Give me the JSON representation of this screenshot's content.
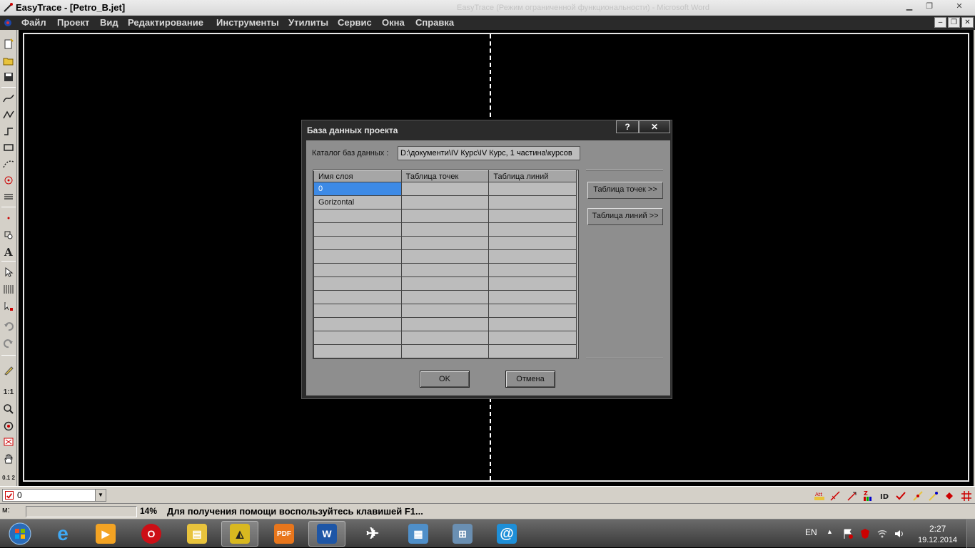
{
  "window": {
    "title": "EasyTrace - [Petro_B.jet]",
    "background_title": "EasyTrace (Режим ограниченной функциональности) - Microsoft Word"
  },
  "menu": [
    "Файл",
    "Проект",
    "Вид",
    "Редактирование",
    "Инструменты",
    "Утилиты",
    "Сервис",
    "Окна",
    "Справка"
  ],
  "toolbar": {
    "scale_label": "1:1",
    "coords_label": "0.1 2"
  },
  "dialog": {
    "title": "База данных проекта",
    "help_label": "?",
    "close_label": "✕",
    "catalog_label": "Каталог баз данных :",
    "catalog_value": "D:\\документи\\IV Курс\\IV Курс, 1 частина\\курсов",
    "columns": [
      "Имя слоя",
      "Таблица точек",
      "Таблица линий"
    ],
    "rows": [
      [
        "0",
        "",
        ""
      ],
      [
        "Gorizontal",
        "",
        ""
      ],
      [
        "",
        "",
        ""
      ],
      [
        "",
        "",
        ""
      ],
      [
        "",
        "",
        ""
      ],
      [
        "",
        "",
        ""
      ],
      [
        "",
        "",
        ""
      ],
      [
        "",
        "",
        ""
      ],
      [
        "",
        "",
        ""
      ],
      [
        "",
        "",
        ""
      ],
      [
        "",
        "",
        ""
      ],
      [
        "",
        "",
        ""
      ],
      [
        "",
        "",
        ""
      ]
    ],
    "points_table_button": "Таблица точек >>",
    "lines_table_button": "Таблица линий >>",
    "ok_button": "OK",
    "cancel_button": "Отмена"
  },
  "layerbar": {
    "current_layer": "0"
  },
  "statusbar": {
    "mode_label": "м:",
    "zoom": "14%",
    "help_text": "Для получения помощи воспользуйтесь клавишей F1..."
  },
  "taskbar": {
    "language": "EN",
    "time": "2:27",
    "date": "19.12.2014",
    "apps": [
      "start-orb",
      "internet-explorer",
      "media-player",
      "opera",
      "file-explorer",
      "easytrace",
      "pdf-reader",
      "microsoft-word",
      "paper-plane",
      "image-viewer",
      "network-app",
      "mail-app"
    ]
  },
  "colors": {
    "canvas": "#000000",
    "dialog_body": "#8e8e8e",
    "selection": "#3d8ae6",
    "menu_bar": "#2a2a2a"
  }
}
